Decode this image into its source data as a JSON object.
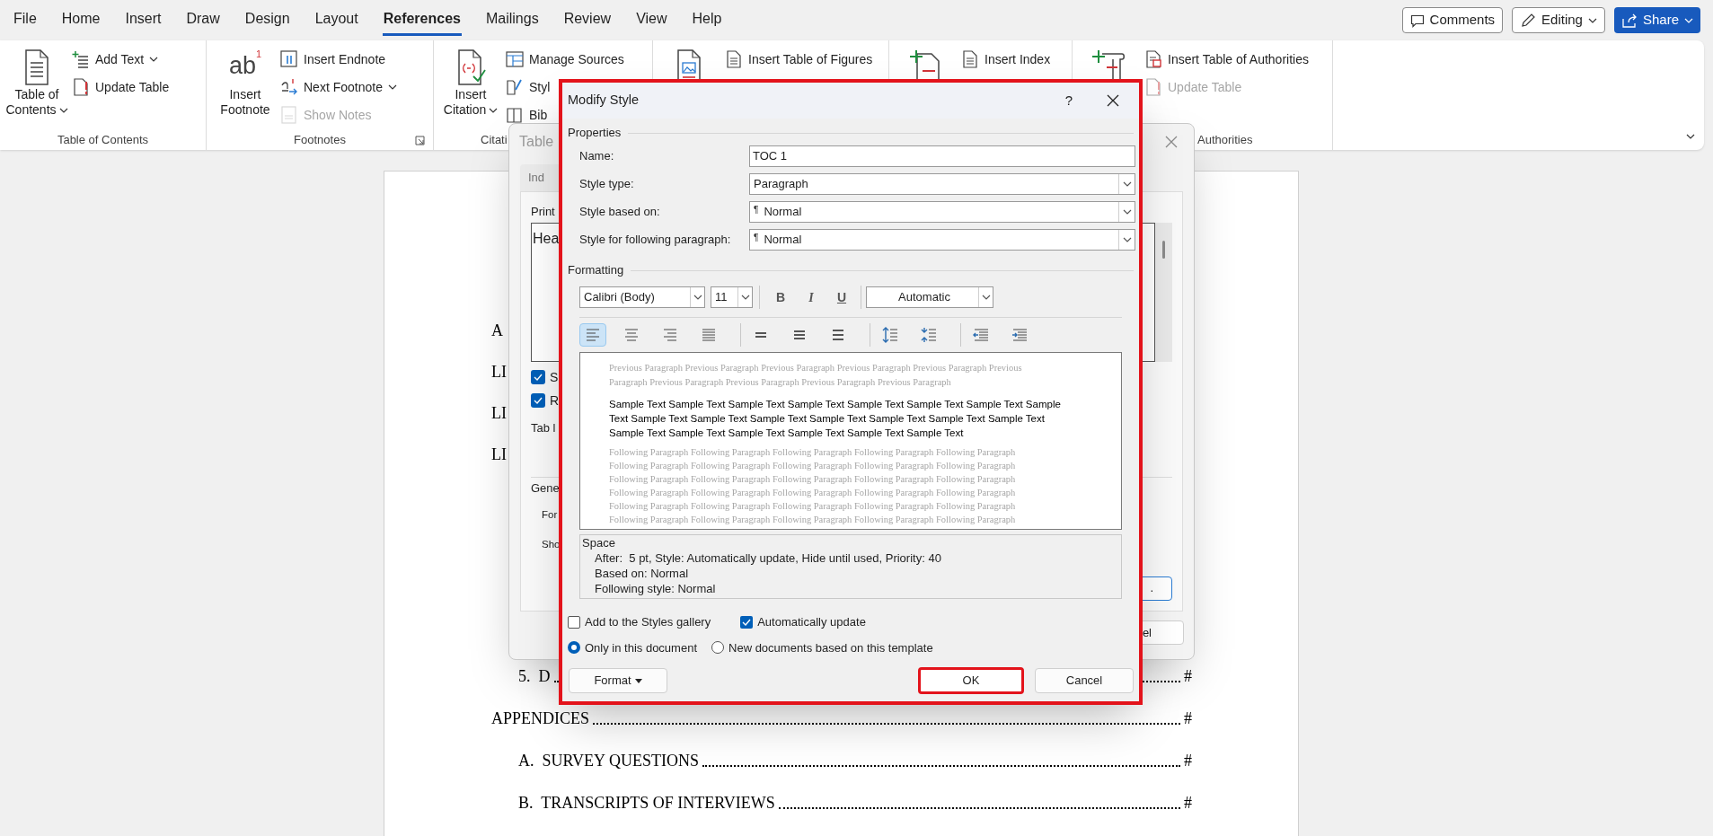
{
  "menu_tabs": [
    {
      "label": "File",
      "selected": false
    },
    {
      "label": "Home",
      "selected": false
    },
    {
      "label": "Insert",
      "selected": false
    },
    {
      "label": "Draw",
      "selected": false
    },
    {
      "label": "Design",
      "selected": false
    },
    {
      "label": "Layout",
      "selected": false
    },
    {
      "label": "References",
      "selected": true
    },
    {
      "label": "Mailings",
      "selected": false
    },
    {
      "label": "Review",
      "selected": false
    },
    {
      "label": "View",
      "selected": false
    },
    {
      "label": "Help",
      "selected": false
    }
  ],
  "top_buttons": {
    "comments": "Comments",
    "editing": "Editing",
    "share": "Share"
  },
  "ribbon": {
    "groups": [
      {
        "label": "Table of Contents",
        "large": {
          "lines": [
            "Table of",
            "Contents"
          ],
          "dropdown": true
        },
        "small": [
          {
            "label": "Add Text",
            "dropdown": true
          },
          {
            "label": "Update Table"
          }
        ]
      },
      {
        "label": "Footnotes",
        "launcher": true,
        "large": {
          "glyph": "ab",
          "glyph_mark": "1",
          "lines": [
            "Insert",
            "Footnote"
          ]
        },
        "small": [
          {
            "label": "Insert Endnote"
          },
          {
            "label": "Next Footnote",
            "dropdown": true
          },
          {
            "label": "Show Notes",
            "disabled": true
          }
        ]
      },
      {
        "label": "Citati",
        "large": {
          "lines": [
            "Insert",
            "Citation"
          ],
          "dropdown": true
        },
        "small": [
          {
            "label": "Manage Sources"
          },
          {
            "label": "Styl"
          },
          {
            "label": "Bib"
          }
        ]
      },
      {
        "small": [
          {
            "label": "Insert Table of Figures"
          }
        ]
      },
      {
        "small": [
          {
            "label": "Insert Index"
          }
        ]
      },
      {
        "label": "Authorities",
        "small": [
          {
            "label": "Insert Table of Authorities"
          },
          {
            "label": "Update Table",
            "disabled": true
          }
        ]
      }
    ]
  },
  "document": {
    "upper_lines": [
      {
        "text": "A"
      },
      {
        "text": "LI"
      },
      {
        "text": "LI"
      },
      {
        "text": "LI"
      }
    ],
    "lower_lines": [
      {
        "text": "5.  D",
        "kind": "sub",
        "page": "#"
      },
      {
        "text": "APPENDICES",
        "kind": "main",
        "page": "#"
      },
      {
        "text": "A.  SURVEY QUESTIONS",
        "kind": "sub",
        "page": "#"
      },
      {
        "text": "B.  TRANSCRIPTS OF INTERVIEWS",
        "kind": "sub",
        "page": "#"
      }
    ]
  },
  "toc_dialog": {
    "title": "Table",
    "tab": "Ind",
    "print_label": "Print",
    "preview_lines": [
      "Hea"
    ],
    "checkboxes": [
      {
        "label": "S",
        "checked": true
      },
      {
        "label": "R",
        "checked": true
      }
    ],
    "tab_leader_label": "Tab l",
    "general_label": "Gene",
    "general_rows": [
      "For",
      "Sho"
    ],
    "modify_button": ".",
    "cancel_button": "el"
  },
  "modify_style": {
    "title": "Modify Style",
    "help": "?",
    "highlighted": true,
    "properties_heading": "Properties",
    "fields": [
      {
        "label": "Name:",
        "kind": "text",
        "value": "TOC 1"
      },
      {
        "label": "Style type:",
        "kind": "select",
        "value": "Paragraph"
      },
      {
        "label": "Style based on:",
        "kind": "select",
        "marker": "¶",
        "value": "Normal"
      },
      {
        "label": "Style for following paragraph:",
        "kind": "select",
        "marker": "¶",
        "value": "Normal"
      }
    ],
    "formatting_heading": "Formatting",
    "font": "Calibri (Body)",
    "size": "11",
    "char_buttons": [
      {
        "label": "B",
        "kind": "bold",
        "selected": false
      },
      {
        "label": "I",
        "kind": "italic",
        "selected": false
      },
      {
        "label": "U",
        "kind": "underline",
        "selected": false
      }
    ],
    "font_color_label": "Automatic",
    "paragraph_button_groups": [
      [
        {
          "kind": "align-left",
          "selected": true
        },
        {
          "kind": "align-center",
          "selected": false
        },
        {
          "kind": "align-right",
          "selected": false
        },
        {
          "kind": "justify",
          "selected": false
        }
      ],
      [
        {
          "kind": "single-spacing",
          "selected": false
        },
        {
          "kind": "onehalf-spacing",
          "selected": false
        },
        {
          "kind": "double-spacing",
          "selected": false
        }
      ],
      [
        {
          "kind": "space-increase",
          "selected": false
        },
        {
          "kind": "space-decrease",
          "selected": false
        }
      ],
      [
        {
          "kind": "indent-decrease",
          "selected": false
        },
        {
          "kind": "indent-increase",
          "selected": false
        }
      ]
    ],
    "preview": {
      "previous_lines": [
        "Previous Paragraph Previous Paragraph Previous Paragraph Previous Paragraph Previous Paragraph Previous",
        "Paragraph Previous Paragraph Previous Paragraph Previous Paragraph Previous Paragraph"
      ],
      "sample_lines": [
        "Sample Text Sample Text Sample Text Sample Text Sample Text Sample Text Sample Text Sample",
        "Text Sample Text Sample Text Sample Text Sample Text Sample Text Sample Text Sample Text",
        "Sample Text Sample Text Sample Text Sample Text Sample Text Sample Text"
      ],
      "following_lines": [
        "Following Paragraph Following Paragraph Following Paragraph Following Paragraph Following Paragraph",
        "Following Paragraph Following Paragraph Following Paragraph Following Paragraph Following Paragraph",
        "Following Paragraph Following Paragraph Following Paragraph Following Paragraph Following Paragraph",
        "Following Paragraph Following Paragraph Following Paragraph Following Paragraph Following Paragraph",
        "Following Paragraph Following Paragraph Following Paragraph Following Paragraph Following Paragraph",
        "Following Paragraph Following Paragraph Following Paragraph Following Paragraph Following Paragraph"
      ]
    },
    "description": {
      "heading": "Space",
      "lines": [
        "After:  5 pt, Style: Automatically update, Hide until used, Priority: 40",
        "Based on: Normal",
        "Following style: Normal"
      ]
    },
    "checkboxes": [
      {
        "label": "Add to the Styles gallery",
        "checked": false
      },
      {
        "label": "Automatically update",
        "checked": true
      }
    ],
    "radios": [
      {
        "label": "Only in this document",
        "selected": true
      },
      {
        "label": "New documents based on this template",
        "selected": false
      }
    ],
    "format_button": "Format",
    "ok_button": {
      "label": "OK",
      "highlighted": true
    },
    "cancel_button": "Cancel"
  }
}
